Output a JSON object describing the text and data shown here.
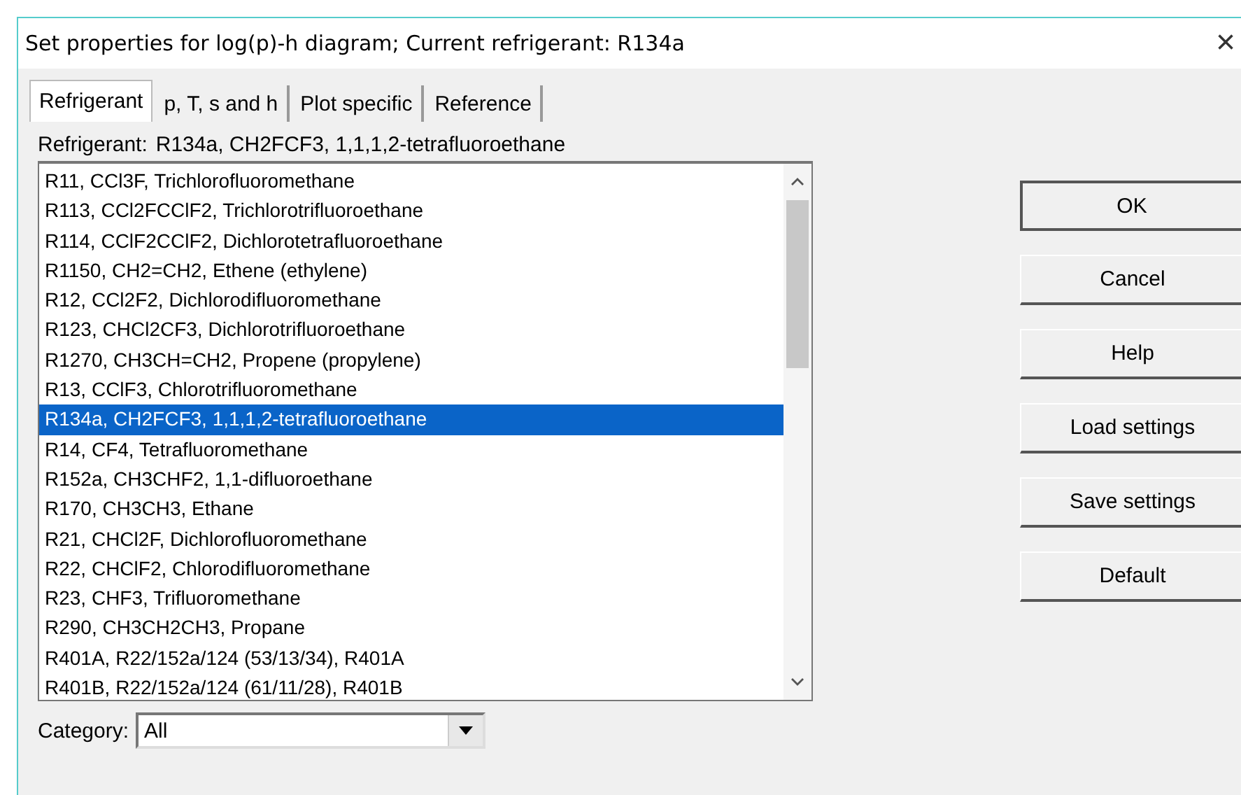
{
  "window": {
    "title": "Set properties for log(p)-h diagram; Current refrigerant: R134a",
    "close": "×"
  },
  "tabs": [
    {
      "label": "Refrigerant",
      "selected": true
    },
    {
      "label": "p, T, s and h",
      "selected": false
    },
    {
      "label": "Plot specific",
      "selected": false
    },
    {
      "label": "Reference",
      "selected": false
    }
  ],
  "refrigerant_label": "Refrigerant:",
  "refrigerant_value": "R134a, CH2FCF3, 1,1,1,2-tetrafluoroethane",
  "list": [
    {
      "text": "R11, CCl3F, Trichlorofluoromethane",
      "selected": false
    },
    {
      "text": "R113, CCl2FCClF2, Trichlorotrifluoroethane",
      "selected": false
    },
    {
      "text": "R114, CClF2CClF2, Dichlorotetrafluoroethane",
      "selected": false
    },
    {
      "text": "R1150, CH2=CH2, Ethene (ethylene)",
      "selected": false
    },
    {
      "text": "R12, CCl2F2, Dichlorodifluoromethane",
      "selected": false
    },
    {
      "text": "R123, CHCl2CF3, Dichlorotrifluoroethane",
      "selected": false
    },
    {
      "text": "R1270, CH3CH=CH2, Propene (propylene)",
      "selected": false
    },
    {
      "text": "R13, CClF3, Chlorotrifluoromethane",
      "selected": false
    },
    {
      "text": "R134a, CH2FCF3, 1,1,1,2-tetrafluoroethane",
      "selected": true
    },
    {
      "text": "R14, CF4, Tetrafluoromethane",
      "selected": false
    },
    {
      "text": "R152a, CH3CHF2, 1,1-difluoroethane",
      "selected": false
    },
    {
      "text": "R170, CH3CH3, Ethane",
      "selected": false
    },
    {
      "text": "R21, CHCl2F, Dichlorofluoromethane",
      "selected": false
    },
    {
      "text": "R22, CHClF2, Chlorodifluoromethane",
      "selected": false
    },
    {
      "text": "R23, CHF3, Trifluoromethane",
      "selected": false
    },
    {
      "text": "R290, CH3CH2CH3, Propane",
      "selected": false
    },
    {
      "text": "R401A, R22/152a/124 (53/13/34), R401A",
      "selected": false
    },
    {
      "text": "R401B, R22/152a/124 (61/11/28), R401B",
      "selected": false
    }
  ],
  "category": {
    "label": "Category:",
    "value": "All"
  },
  "buttons": [
    {
      "label": "OK",
      "default": true
    },
    {
      "label": "Cancel",
      "default": false
    },
    {
      "label": "Help",
      "default": false
    },
    {
      "label": "Load settings",
      "default": false
    },
    {
      "label": "Save settings",
      "default": false
    },
    {
      "label": "Default",
      "default": false
    }
  ]
}
